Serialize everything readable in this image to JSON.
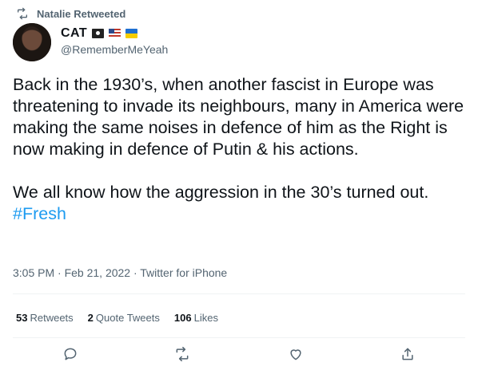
{
  "retweeted_by": "Natalie Retweeted",
  "author": {
    "display_name": "CAT",
    "name_emojis": [
      "pirate-flag",
      "us-flag",
      "ukraine-flag"
    ],
    "handle": "@RememberMeYeah"
  },
  "tweet": {
    "body": "Back in the 1930’s, when another fascist in Europe was threatening to invade its neighbours, many in America were making the same noises in defence of him as the Right is now making in defence of Putin & his actions.\n\nWe all know how the aggression in the 30’s turned out.",
    "hashtag": "#Fresh"
  },
  "meta": "3:05 PM · Feb 21, 2022 · Twitter for iPhone",
  "stats": {
    "retweets_count": "53",
    "retweets_label": "Retweets",
    "quotes_count": "2",
    "quotes_label": "Quote Tweets",
    "likes_count": "106",
    "likes_label": "Likes"
  },
  "icons": {
    "retweet_header": "retweet-icon",
    "reply": "reply-icon",
    "retweet": "retweet-icon",
    "like": "heart-icon",
    "share": "share-icon"
  },
  "colors": {
    "text": "#0f1419",
    "secondary": "#536471",
    "hashtag": "#1d9bf0",
    "divider": "#eff3f4"
  }
}
